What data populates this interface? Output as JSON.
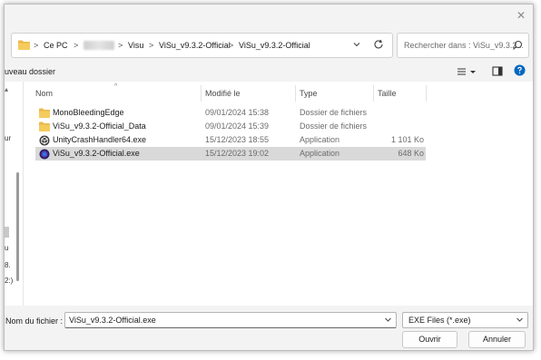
{
  "window": {
    "close_glyph": "✕"
  },
  "address": {
    "crumbs": [
      "Ce PC",
      "Visu",
      "ViSu_v9.3.2-Official",
      "ViSu_v9.3.2-Official"
    ],
    "separator": ">",
    "dropdown_glyph": "⌄",
    "refresh_glyph": "↻"
  },
  "search": {
    "placeholder": "Rechercher dans : ViSu_v9.3.2..."
  },
  "toolbar": {
    "new_folder_label": "uveau dossier"
  },
  "nav_fragments": [
    "ur",
    "u",
    "8.",
    "2:)"
  ],
  "columns": {
    "name": "Nom",
    "modified": "Modifié le",
    "type": "Type",
    "size": "Taille"
  },
  "files": [
    {
      "icon": "folder-icon",
      "name": "MonoBleedingEdge",
      "modified": "09/01/2024 15:38",
      "type": "Dossier de fichiers",
      "size": "",
      "selected": false
    },
    {
      "icon": "folder-icon",
      "name": "ViSu_v9.3.2-Official_Data",
      "modified": "09/01/2024 15:39",
      "type": "Dossier de fichiers",
      "size": "",
      "selected": false
    },
    {
      "icon": "unity-icon",
      "name": "UnityCrashHandler64.exe",
      "modified": "15/12/2023 18:55",
      "type": "Application",
      "size": "1 101 Ko",
      "selected": false
    },
    {
      "icon": "visu-app-icon",
      "name": "ViSu_v9.3.2-Official.exe",
      "modified": "15/12/2023 19:02",
      "type": "Application",
      "size": "648 Ko",
      "selected": true
    }
  ],
  "footer": {
    "filename_label": "Nom du fichier :",
    "filename_value": "ViSu_v9.3.2-Official.exe",
    "filter_value": "EXE Files (*.exe)",
    "open_label": "Ouvrir",
    "cancel_label": "Annuler"
  },
  "colors": {
    "selection": "#d9d9d9",
    "folder": "#e8b84a",
    "accent": "#0067c0"
  }
}
